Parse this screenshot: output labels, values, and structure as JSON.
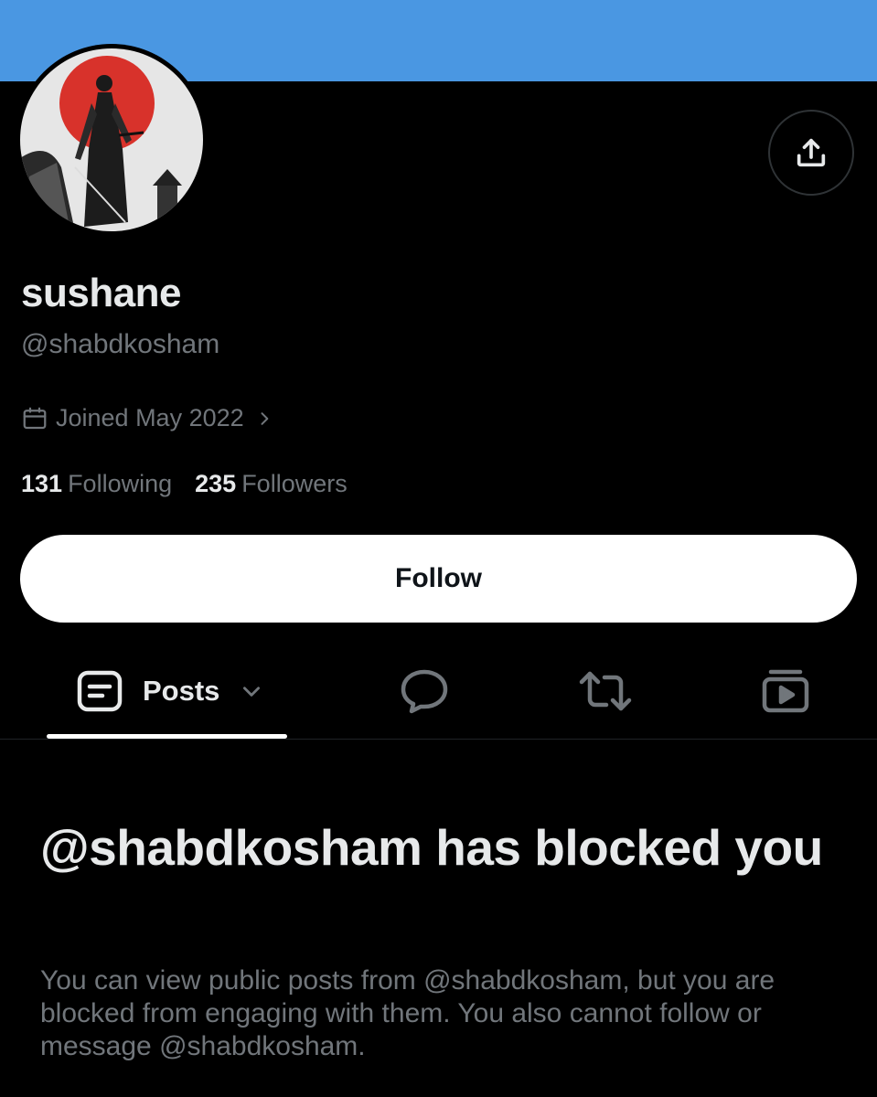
{
  "profile": {
    "display_name": "sushane",
    "handle": "@shabdkosham",
    "joined": "Joined May 2022",
    "following_count": "131",
    "following_label": "Following",
    "followers_count": "235",
    "followers_label": "Followers"
  },
  "actions": {
    "follow_label": "Follow",
    "share_icon": "share-icon"
  },
  "tabs": [
    {
      "label": "Posts",
      "icon": "posts-icon",
      "selected": true
    },
    {
      "label": "",
      "icon": "replies-icon",
      "selected": false
    },
    {
      "label": "",
      "icon": "reposts-icon",
      "selected": false
    },
    {
      "label": "",
      "icon": "media-icon",
      "selected": false
    }
  ],
  "blocked": {
    "title": "@shabdkosham has blocked you",
    "description": "You can view public posts from @shabdkosham, but you are blocked from engaging with them. You also cannot follow or message @shabdkosham."
  },
  "colors": {
    "banner": "#4a97e2",
    "background": "#000000",
    "primary_text": "#e7e9ea",
    "secondary_text": "#71767b",
    "avatar_sun": "#d8322b"
  }
}
